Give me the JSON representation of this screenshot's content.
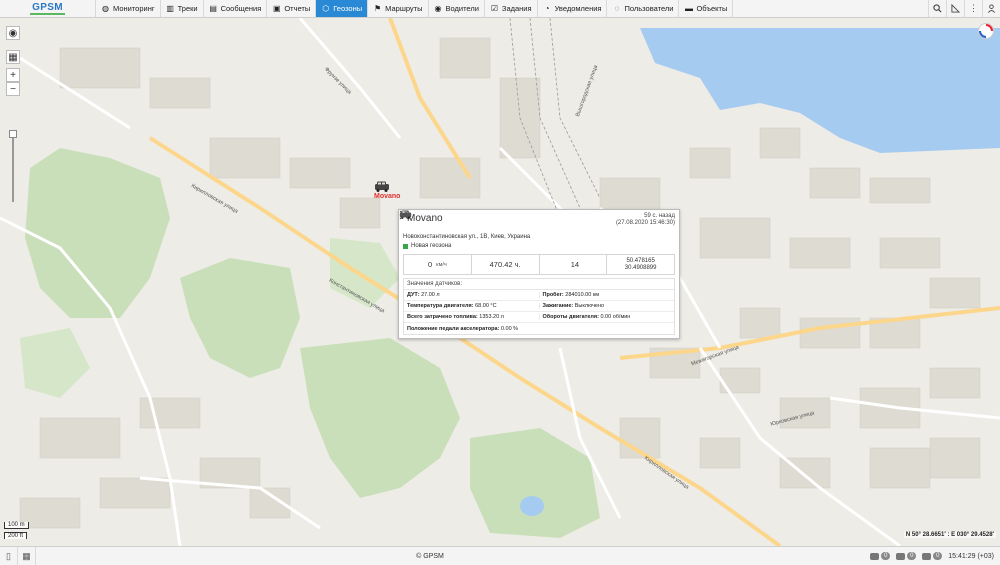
{
  "app": {
    "logo": "GPSM"
  },
  "nav": [
    {
      "label": "Мониторинг",
      "icon": "globe-icon"
    },
    {
      "label": "Треки",
      "icon": "chart-icon"
    },
    {
      "label": "Сообщения",
      "icon": "list-icon"
    },
    {
      "label": "Отчеты",
      "icon": "report-icon"
    },
    {
      "label": "Геозоны",
      "icon": "geofence-icon",
      "active": true
    },
    {
      "label": "Маршруты",
      "icon": "route-icon"
    },
    {
      "label": "Водители",
      "icon": "driver-icon"
    },
    {
      "label": "Задания",
      "icon": "tasks-icon"
    },
    {
      "label": "Уведомления",
      "icon": "bell-icon"
    },
    {
      "label": "Пользователи",
      "icon": "user-icon"
    },
    {
      "label": "Объекты",
      "icon": "truck-icon"
    }
  ],
  "topbar_right": [
    "search-icon",
    "measure-icon",
    "more-icon",
    "account-icon"
  ],
  "map": {
    "scale_top": "100 m",
    "scale_bottom": "200 ft",
    "coords": "N 50° 28.6651′ : E 030° 29.4528′",
    "labels": [
      "Кирилловская улица",
      "Константиновская улица",
      "Межигорская улица",
      "Фрунзе улица",
      "Вышгородская улица",
      "Юрковская улица",
      "Кирилловская улица"
    ]
  },
  "vehicle": {
    "name": "Movano",
    "ago": "59 с. назад",
    "datetime": "(27.08.2020 15:46:30)",
    "address": "Новоконстантиновская ул., 1В, Киев, Украина",
    "geofence": "Новая геозона",
    "speed": "0",
    "speed_unit": "км/ч",
    "engine_hours": "470.42 ч.",
    "satellites": "14",
    "lat": "50.478165",
    "lon": "30.4908899",
    "sensors_title": "Значения датчиков:",
    "sensors": [
      [
        {
          "k": "ДУТ:",
          "v": "27.00 л"
        },
        {
          "k": "Пробег:",
          "v": "284010.00 км"
        }
      ],
      [
        {
          "k": "Температура двигателя:",
          "v": "68.00 °C"
        },
        {
          "k": "Зажигание:",
          "v": "Выключено"
        }
      ],
      [
        {
          "k": "Всего затрачено топлива:",
          "v": "1353.20 л"
        },
        {
          "k": "Обороты двигателя:",
          "v": "0.00 об/мин"
        }
      ],
      [
        {
          "k": "Положение педали акселератора:",
          "v": "0.00 %"
        },
        {
          "k": "",
          "v": ""
        }
      ]
    ]
  },
  "footer": {
    "copyright": "© GPSM",
    "counters": [
      "0",
      "0",
      "0"
    ],
    "time": "15:41:29 (+03)"
  }
}
